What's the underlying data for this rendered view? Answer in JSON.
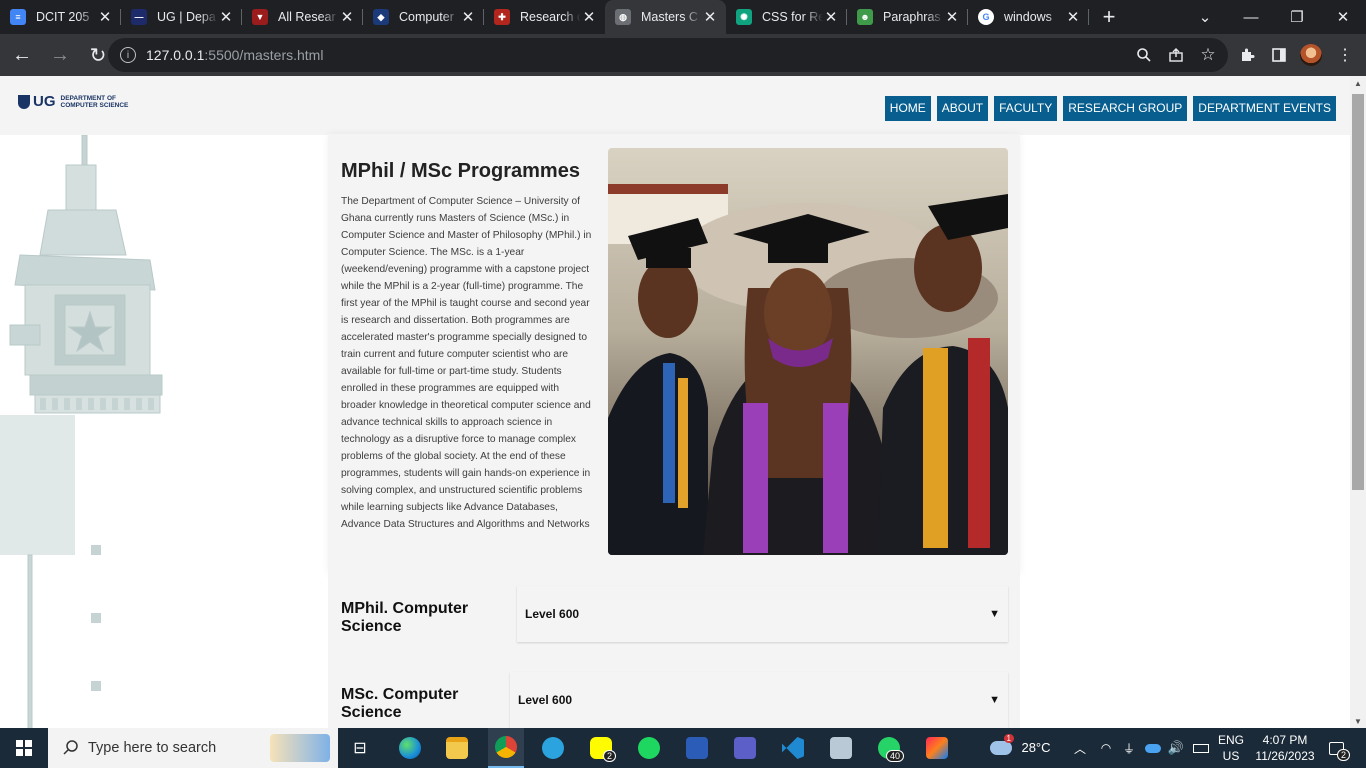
{
  "browser": {
    "tabs": [
      {
        "title": "DCIT 205",
        "fav_color": "#4285f4",
        "fav_glyph": "≡",
        "active": false
      },
      {
        "title": "UG | Depa",
        "fav_color": "#1d2b6b",
        "fav_glyph": "—",
        "active": false
      },
      {
        "title": "All Resear",
        "fav_color": "#9b1c1c",
        "fav_glyph": "▼",
        "active": false
      },
      {
        "title": "Computer",
        "fav_color": "#1a3a7a",
        "fav_glyph": "◆",
        "active": false
      },
      {
        "title": "Research c",
        "fav_color": "#b3261e",
        "fav_glyph": "✚",
        "active": false
      },
      {
        "title": "Masters C",
        "fav_color": "#6b6f74",
        "fav_glyph": "◍",
        "active": true
      },
      {
        "title": "CSS for Re",
        "fav_color": "#10a37f",
        "fav_glyph": "✺",
        "active": false
      },
      {
        "title": "Paraphras",
        "fav_color": "#3f9a4a",
        "fav_glyph": "☻",
        "active": false
      },
      {
        "title": "windows",
        "fav_color": "#ffffff",
        "fav_glyph": "G",
        "active": false
      }
    ],
    "address": {
      "host": "127.0.0.1",
      "path": ":5500/masters.html"
    }
  },
  "site": {
    "logo": {
      "short": "UG",
      "dept_line1": "DEPARTMENT OF",
      "dept_line2": "COMPUTER SCIENCE"
    },
    "nav": [
      "HOME",
      "ABOUT",
      "FACULTY",
      "RESEARCH GROUP",
      "DEPARTMENT EVENTS"
    ],
    "intro": {
      "title": "MPhil / MSc Programmes",
      "body": "The Department of Computer Science – University of Ghana currently runs Masters of Science (MSc.) in Computer Science and Master of Philosophy (MPhil.) in Computer Science. The MSc. is a 1-year (weekend/evening) programme with a capstone project while the MPhil is a 2-year (full-time) programme. The first year of the MPhil is taught course and second year is research and dissertation. Both programmes are accelerated master's programme specially designed to train current and future computer scientist who are available for full-time or part-time study. Students enrolled in these programmes are equipped with broader knowledge in theoretical computer science and advance technical skills to approach science in technology as a disruptive force to manage complex problems of the global society. At the end of these programmes, students will gain hands-on experience in solving complex, and unstructured scientific problems while learning subjects like Advance Databases, Advance Data Structures and Algorithms and Networks"
    },
    "programmes": [
      {
        "name": "MPhil. Computer Science",
        "selected": "Level 600"
      },
      {
        "name": "MSc. Computer Science",
        "selected": "Level 600"
      }
    ],
    "caret": "▼"
  },
  "taskbar": {
    "search_placeholder": "Type here to search",
    "weather": "28°C",
    "lang1": "ENG",
    "lang2": "US",
    "time": "4:07 PM",
    "date": "11/26/2023",
    "snapchat_badge": "2",
    "whatsapp_badge": "40",
    "notif_badge": "2",
    "weather_badge": "1"
  }
}
